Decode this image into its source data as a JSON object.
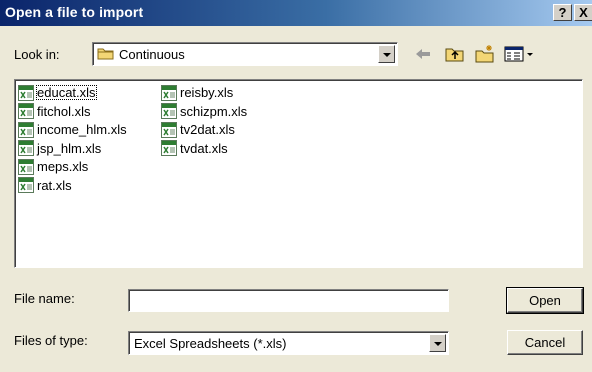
{
  "window": {
    "title": "Open a file to import",
    "help_glyph": "?",
    "close_glyph": "X"
  },
  "lookin": {
    "label": "Look in:",
    "value": "Continuous"
  },
  "files": [
    {
      "name": "educat.xls",
      "icon": "excel-file-icon",
      "focused": true
    },
    {
      "name": "fitchol.xls",
      "icon": "excel-file-icon"
    },
    {
      "name": "income_hlm.xls",
      "icon": "excel-file-icon"
    },
    {
      "name": "jsp_hlm.xls",
      "icon": "excel-file-icon"
    },
    {
      "name": "meps.xls",
      "icon": "excel-file-icon"
    },
    {
      "name": "rat.xls",
      "icon": "excel-file-icon"
    },
    {
      "name": "reisby.xls",
      "icon": "excel-file-icon"
    },
    {
      "name": "schizpm.xls",
      "icon": "excel-file-icon"
    },
    {
      "name": "tv2dat.xls",
      "icon": "excel-file-icon"
    },
    {
      "name": "tvdat.xls",
      "icon": "excel-file-icon"
    }
  ],
  "filename": {
    "label": "File name:",
    "value": ""
  },
  "filetype": {
    "label": "Files of type:",
    "value": "Excel Spreadsheets (*.xls)"
  },
  "buttons": {
    "open": "Open",
    "cancel": "Cancel"
  },
  "colors": {
    "title_start": "#0a246a",
    "title_end": "#a6caf0",
    "face": "#ece9d8",
    "excel_green": "#2e7d32"
  }
}
